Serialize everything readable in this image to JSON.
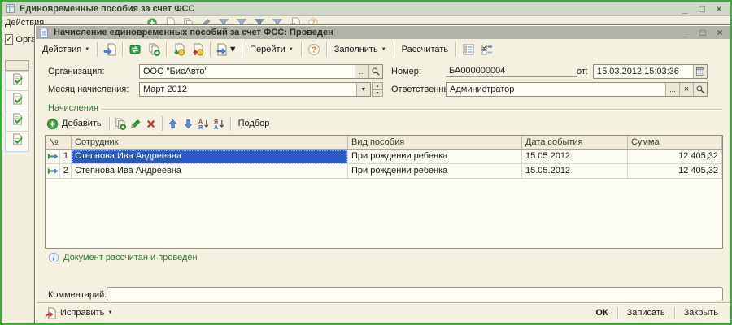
{
  "outer_window": {
    "title": "Единовременные пособия за счет ФСС",
    "actions_menu": "Действия",
    "org_filter": "Организация",
    "controls": {
      "minimize": "_",
      "maximize": "□",
      "close": "×"
    }
  },
  "dialog": {
    "title": "Начисление единовременных пособий за счет ФСС: Проведен",
    "controls": {
      "minimize": "_",
      "maximize": "□",
      "close": "×"
    },
    "toolbar": {
      "actions": "Действия",
      "goto": "Перейти",
      "fill": "Заполнить",
      "calculate": "Рассчитать"
    },
    "fields": {
      "organization_label": "Организация:",
      "organization_value": "ООО \"БисАвто\"",
      "month_label": "Месяц начисления:",
      "month_value": "Март 2012",
      "number_label": "Номер:",
      "number_value": "БА000000004",
      "date_label": "от:",
      "date_value": "15.03.2012 15:03:36",
      "responsible_label": "Ответственный:",
      "responsible_value": "Администратор"
    },
    "accruals": {
      "section_title": "Начисления",
      "add": "Добавить",
      "pick": "Подбор",
      "columns": [
        "№",
        "Сотрудник",
        "Вид пособия",
        "Дата события",
        "Сумма"
      ],
      "rows": [
        {
          "num": "1",
          "employee": "Степнова Ива Андреевна",
          "benefit": "При рождении ребенка",
          "date": "15.05.2012",
          "amount": "12 405,32"
        },
        {
          "num": "2",
          "employee": "Степнова Ива Андреевна",
          "benefit": "При рождении ребенка",
          "date": "15.05.2012",
          "amount": "12 405,32"
        }
      ]
    },
    "status": "Документ рассчитан и проведен",
    "comment_label": "Комментарий:",
    "comment_value": "",
    "footer": {
      "fix": "Исправить",
      "ok": "ОК",
      "save": "Записать",
      "close": "Закрыть"
    }
  },
  "icons": {
    "dropdown": "▼",
    "ellipsis": "...",
    "clear": "×",
    "check": "✓",
    "spin_up": "▲",
    "spin_down": "▼"
  },
  "colors": {
    "selection": "#2a5ac0",
    "status_green": "#2f7d2f",
    "screenshot_border": "#33b233",
    "beige_bg": "#f2efdf"
  }
}
